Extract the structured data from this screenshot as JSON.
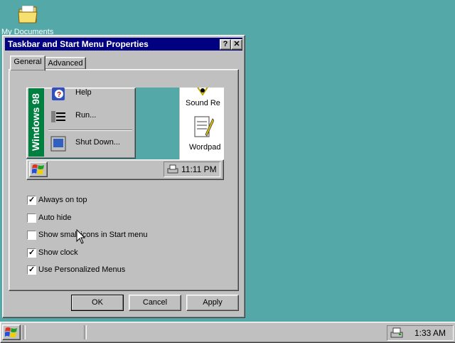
{
  "desktop": {
    "icon_label": "My Documents"
  },
  "dialog": {
    "title": "Taskbar and Start Menu Properties",
    "help_btn": "?",
    "close_btn": "✕",
    "tabs": [
      {
        "label": "General"
      },
      {
        "label": "Advanced"
      }
    ],
    "preview": {
      "banner": "Windows 98",
      "menu_items": [
        {
          "label": "Help"
        },
        {
          "label": "Run..."
        },
        {
          "label": "Shut Down..."
        }
      ],
      "explorer_items": [
        {
          "label": "Sound Re"
        },
        {
          "label": "Wordpad"
        }
      ],
      "clock": "11:11 PM"
    },
    "options": [
      {
        "label": "Always on top",
        "checked": true
      },
      {
        "label": "Auto hide",
        "checked": false
      },
      {
        "label": "Show small icons in Start menu",
        "checked": false
      },
      {
        "label": "Show clock",
        "checked": true
      },
      {
        "label": "Use Personalized Menus",
        "checked": true
      }
    ],
    "buttons": {
      "ok": "OK",
      "cancel": "Cancel",
      "apply": "Apply"
    }
  },
  "taskbar": {
    "clock": "1:33 AM"
  },
  "colors": {
    "desktop": "#55a8a8",
    "title_bar": "#000080",
    "face": "#c0c0c0",
    "banner": "#008040"
  }
}
